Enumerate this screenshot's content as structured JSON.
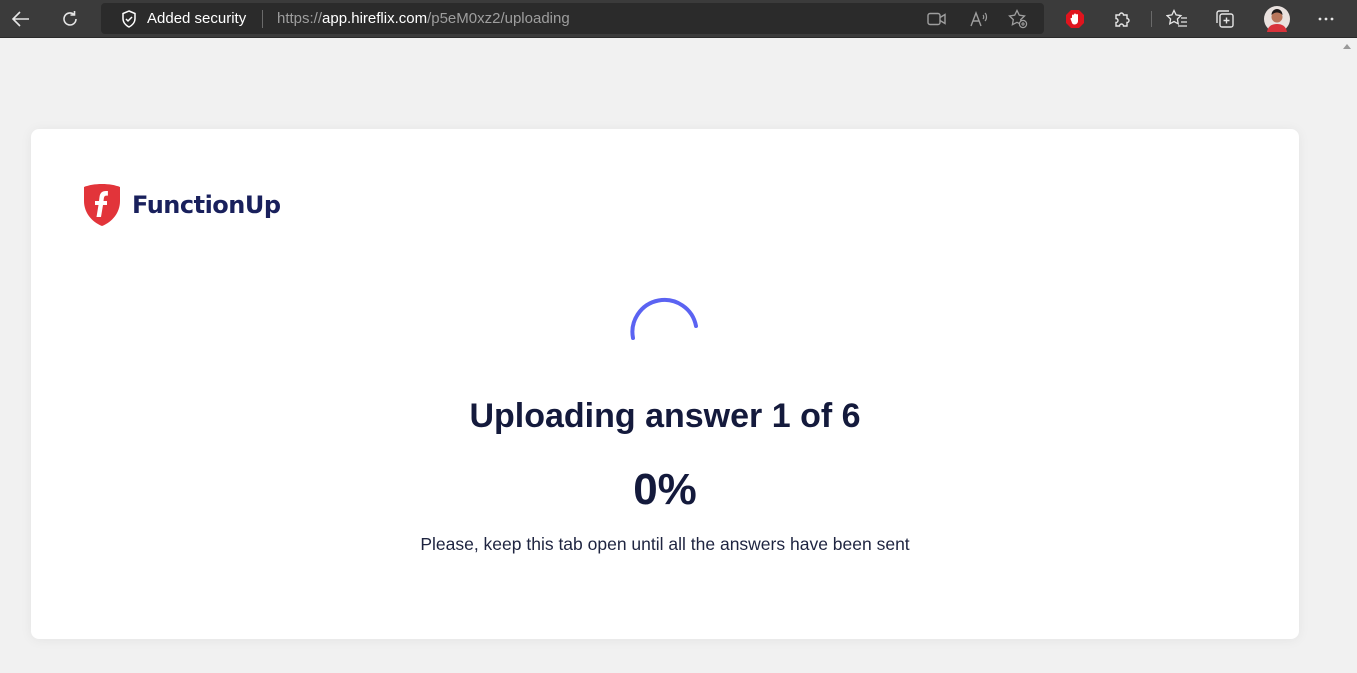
{
  "browser": {
    "security_label": "Added security",
    "url_prefix": "https://",
    "url_host": "app.hireflix.com",
    "url_path": "/p5eM0xz2/uploading",
    "icons": [
      "back-icon",
      "refresh-icon",
      "shield-icon",
      "camera-icon",
      "read-aloud-icon",
      "add-favorite-icon",
      "extension-stop-icon",
      "puzzle-icon",
      "favorites-icon",
      "collections-icon",
      "avatar",
      "more-icon"
    ]
  },
  "page": {
    "brand": "FunctionUp",
    "title": "Uploading answer 1 of 6",
    "progress_percent": "0%",
    "note": "Please, keep this tab open until all the answers have been sent"
  },
  "colors": {
    "spinner": "#5b63f2",
    "brand_red": "#e2343a",
    "brand_navy": "#19205c"
  }
}
